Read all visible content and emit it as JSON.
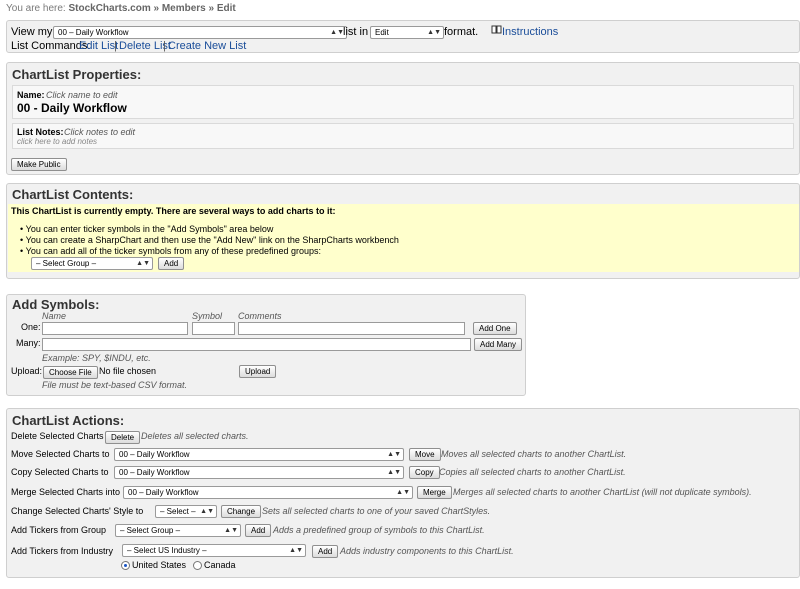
{
  "breadcrumb": {
    "prefix": "You are here:",
    "path": "StockCharts.com » Members » Edit"
  },
  "viewbar": {
    "view_label": "View my",
    "list_select": "00 – Daily Workflow",
    "list_in": "list in",
    "mode_select": "Edit",
    "format": "format.",
    "instructions": "Instructions",
    "commands_label": "List Commands:",
    "edit_list": "Edit List",
    "delete_list": "Delete List",
    "create_list": "Create New List"
  },
  "properties": {
    "heading": "ChartList Properties:",
    "name_label": "Name:",
    "name_hint": "Click name to edit",
    "name_value": "00 - Daily Workflow",
    "notes_label": "List Notes:",
    "notes_hint": "Click notes to edit",
    "notes_placeholder": "click here to add notes",
    "make_public": "Make Public"
  },
  "contents": {
    "heading": "ChartList Contents:",
    "empty_message": "This ChartList is currently empty. There are several ways to add charts to it:",
    "bullets": [
      "You can enter ticker symbols in the \"Add Symbols\" area below",
      "You can create a SharpChart and then use the \"Add New\" link on the SharpCharts workbench",
      "You can add all of the ticker symbols from any of these predefined groups:"
    ],
    "group_select": "– Select Group –",
    "add_button": "Add"
  },
  "add_symbols": {
    "heading": "Add Symbols:",
    "col_name": "Name",
    "col_symbol": "Symbol",
    "col_comments": "Comments",
    "one_label": "One:",
    "add_one": "Add One",
    "many_label": "Many:",
    "add_many": "Add Many",
    "example": "Example: SPY, $INDU, etc.",
    "upload_label": "Upload:",
    "choose_file": "Choose File",
    "no_file": "No file chosen",
    "upload_button": "Upload",
    "csv_note": "File must be text-based CSV format."
  },
  "actions": {
    "heading": "ChartList Actions:",
    "delete_label": "Delete Selected Charts",
    "delete_button": "Delete",
    "delete_note": "Deletes all selected charts.",
    "move_label": "Move Selected Charts to",
    "move_select": "00 – Daily Workflow",
    "move_button": "Move",
    "move_note": "Moves all selected charts to another ChartList.",
    "copy_label": "Copy Selected Charts to",
    "copy_select": "00 – Daily Workflow",
    "copy_button": "Copy",
    "copy_note": "Copies all selected charts to another ChartList.",
    "merge_label": "Merge Selected Charts into",
    "merge_select": "00 – Daily Workflow",
    "merge_button": "Merge",
    "merge_note": "Merges all selected charts to another ChartList (will not duplicate symbols).",
    "style_label": "Change Selected Charts' Style to",
    "style_select": "– Select –",
    "style_button": "Change",
    "style_note": "Sets all selected charts to one of your saved ChartStyles.",
    "group_label": "Add Tickers from Group",
    "group_select": "– Select Group –",
    "group_button": "Add",
    "group_note": "Adds a predefined group of symbols to this ChartList.",
    "industry_label": "Add Tickers from Industry",
    "industry_select": "– Select US Industry –",
    "industry_button": "Add",
    "industry_note": "Adds industry components to this ChartList.",
    "radio_us": "United States",
    "radio_ca": "Canada"
  }
}
